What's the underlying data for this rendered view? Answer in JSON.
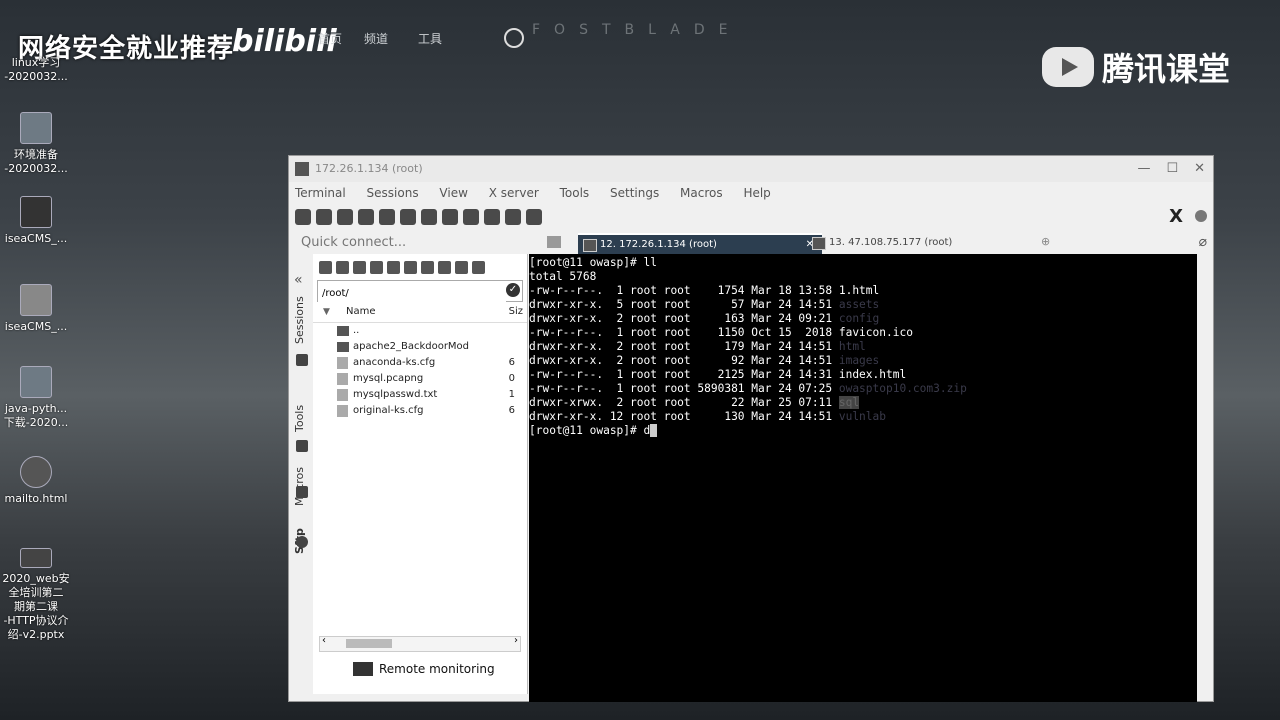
{
  "banner": {
    "title": "网络安全就业推荐",
    "bili": "bilibili",
    "menu": [
      "首页",
      "频道",
      "工具"
    ],
    "ghost": "FOSTBLADE",
    "brand": "腾讯课堂"
  },
  "desktop_icons": [
    {
      "label": "linux学习\n-2020032..."
    },
    {
      "label": "环境准备\n-2020032..."
    },
    {
      "label": "iseaCMS_..."
    },
    {
      "label": "iseaCMS_..."
    },
    {
      "label": "java-pyth...\n下载-2020..."
    },
    {
      "label": "mailto.html"
    },
    {
      "label": "2020_web安\n全培训第二\n期第二课\n-HTTP协议介\n绍-v2.pptx"
    }
  ],
  "window": {
    "title": "172.26.1.134 (root)",
    "menus": [
      "Terminal",
      "Sessions",
      "View",
      "X server",
      "Tools",
      "Settings",
      "Macros",
      "Help"
    ],
    "quick_connect_placeholder": "Quick connect...",
    "tabs": [
      {
        "label": "12. 172.26.1.134 (root)",
        "active": true
      },
      {
        "label": "13. 47.108.75.177 (root)",
        "active": false
      }
    ],
    "side_tabs": [
      "Sessions",
      "Tools",
      "Macros",
      "Sftp"
    ]
  },
  "sftp": {
    "path": "/root/",
    "columns": {
      "name": "Name",
      "size": "Siz"
    },
    "files": [
      {
        "name": "..",
        "size": "",
        "type": "up"
      },
      {
        "name": "apache2_BackdoorMod",
        "size": "",
        "type": "folder"
      },
      {
        "name": "anaconda-ks.cfg",
        "size": "6",
        "type": "file"
      },
      {
        "name": "mysql.pcapng",
        "size": "0",
        "type": "file"
      },
      {
        "name": "mysqlpasswd.txt",
        "size": "1",
        "type": "file"
      },
      {
        "name": "original-ks.cfg",
        "size": "6",
        "type": "file"
      }
    ],
    "remote_monitoring": "Remote monitoring"
  },
  "terminal": {
    "lines": [
      {
        "text": "[root@11 owasp]# ll"
      },
      {
        "text": "total 5768"
      },
      {
        "perm": "-rw-r--r--.",
        "links": "1",
        "user": "root",
        "group": "root",
        "size": "1754",
        "date": "Mar 18 13:58",
        "name": "1.html",
        "kind": "file"
      },
      {
        "perm": "drwxr-xr-x.",
        "links": "5",
        "user": "root",
        "group": "root",
        "size": "57",
        "date": "Mar 24 14:51",
        "name": "assets",
        "kind": "dir"
      },
      {
        "perm": "drwxr-xr-x.",
        "links": "2",
        "user": "root",
        "group": "root",
        "size": "163",
        "date": "Mar 24 09:21",
        "name": "config",
        "kind": "dir"
      },
      {
        "perm": "-rw-r--r--.",
        "links": "1",
        "user": "root",
        "group": "root",
        "size": "1150",
        "date": "Oct 15  2018",
        "name": "favicon.ico",
        "kind": "file"
      },
      {
        "perm": "drwxr-xr-x.",
        "links": "2",
        "user": "root",
        "group": "root",
        "size": "179",
        "date": "Mar 24 14:51",
        "name": "html",
        "kind": "dir"
      },
      {
        "perm": "drwxr-xr-x.",
        "links": "2",
        "user": "root",
        "group": "root",
        "size": "92",
        "date": "Mar 24 14:51",
        "name": "images",
        "kind": "dir"
      },
      {
        "perm": "-rw-r--r--.",
        "links": "1",
        "user": "root",
        "group": "root",
        "size": "2125",
        "date": "Mar 24 14:31",
        "name": "index.html",
        "kind": "file"
      },
      {
        "perm": "-rw-r--r--.",
        "links": "1",
        "user": "root",
        "group": "root",
        "size": "5890381",
        "date": "Mar 24 07:25",
        "name": "owasptop10.com3.zip",
        "kind": "dir"
      },
      {
        "perm": "drwxr-xrwx.",
        "links": "2",
        "user": "root",
        "group": "root",
        "size": "22",
        "date": "Mar 25 07:11",
        "name": "sql",
        "kind": "hl"
      },
      {
        "perm": "drwxr-xr-x.",
        "links": "12",
        "user": "root",
        "group": "root",
        "size": "130",
        "date": "Mar 24 14:51",
        "name": "vulnlab",
        "kind": "dir"
      }
    ],
    "prompt": "[root@11 owasp]# ",
    "input": "d"
  }
}
